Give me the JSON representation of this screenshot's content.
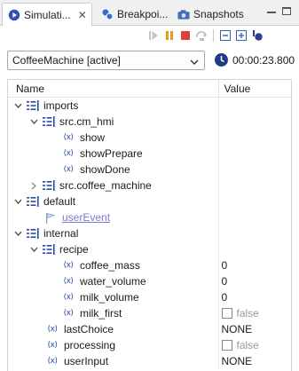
{
  "tabs": [
    {
      "label": "Simulati...",
      "icon": "play-circle-icon",
      "active": true,
      "closable": true
    },
    {
      "label": "Breakpoi...",
      "icon": "breakpoints-icon",
      "active": false
    },
    {
      "label": "Snapshots",
      "icon": "camera-icon",
      "active": false
    }
  ],
  "toolbar": {
    "sim_buttons": [
      "resume-icon",
      "pause-icon",
      "terminate-icon",
      "step-over-icon"
    ],
    "view_buttons": [
      "collapse-all-icon",
      "expand-all-icon",
      "pin-icon"
    ]
  },
  "session": {
    "selected": "CoffeeMachine [active]",
    "elapsed": "00:00:23.800"
  },
  "table": {
    "col_name": "Name",
    "col_value": "Value"
  },
  "rows": [
    {
      "label": "imports",
      "kind": "scope",
      "expanded": true,
      "value": ""
    },
    {
      "label": "src.cm_hmi",
      "kind": "scope",
      "expanded": true,
      "value": ""
    },
    {
      "label": "show",
      "kind": "event",
      "value": ""
    },
    {
      "label": "showPrepare",
      "kind": "event",
      "value": ""
    },
    {
      "label": "showDone",
      "kind": "event",
      "value": ""
    },
    {
      "label": "src.coffee_machine",
      "kind": "scope",
      "expanded": false,
      "value": ""
    },
    {
      "label": "default",
      "kind": "scope",
      "expanded": true,
      "value": ""
    },
    {
      "label": "userEvent",
      "kind": "in-event",
      "value": ""
    },
    {
      "label": "internal",
      "kind": "scope",
      "expanded": true,
      "value": ""
    },
    {
      "label": "recipe",
      "kind": "scope",
      "expanded": true,
      "value": ""
    },
    {
      "label": "coffee_mass",
      "kind": "variable",
      "value": "0"
    },
    {
      "label": "water_volume",
      "kind": "variable",
      "value": "0"
    },
    {
      "label": "milk_volume",
      "kind": "variable",
      "value": "0"
    },
    {
      "label": "milk_first",
      "kind": "variable",
      "value": "false",
      "checkbox": true
    },
    {
      "label": "lastChoice",
      "kind": "variable",
      "value": "NONE"
    },
    {
      "label": "processing",
      "kind": "variable",
      "value": "false",
      "checkbox": true
    },
    {
      "label": "userInput",
      "kind": "variable",
      "value": "NONE"
    }
  ],
  "colors": {
    "accent": "#2f4fa8",
    "link": "#7b7bd0",
    "terminate": "#d9413a",
    "pause": "#e59a1d"
  }
}
